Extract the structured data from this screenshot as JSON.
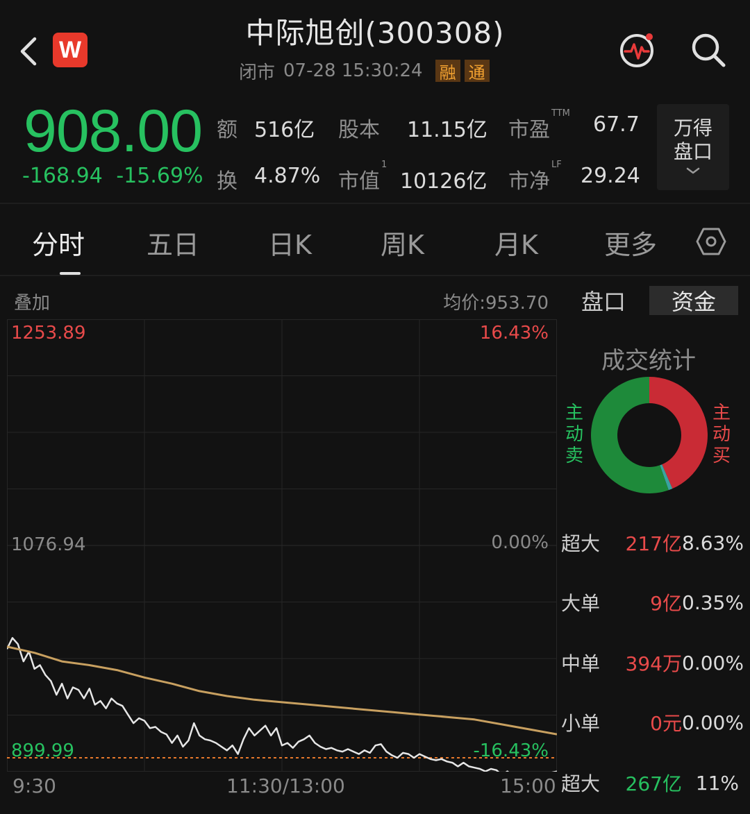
{
  "header": {
    "title": "中际旭创(300308)",
    "status": "闭市",
    "datetime": "07-28 15:30:24",
    "tags": [
      "融",
      "通"
    ],
    "logo_letter": "W"
  },
  "quote": {
    "price": "908.00",
    "change": "-168.94",
    "change_pct": "-15.69%",
    "stats": [
      {
        "label": "额",
        "value": "516亿"
      },
      {
        "label": "股本",
        "value": "11.15亿"
      },
      {
        "label": "市盈",
        "sup": "TTM",
        "value": "67.7"
      },
      {
        "label": "换",
        "value": "4.87%"
      },
      {
        "label": "市值",
        "sup": "1",
        "value": "10126亿"
      },
      {
        "label": "市净",
        "sup": "LF",
        "value": "29.24"
      }
    ],
    "wind_button": [
      "万得",
      "盘口"
    ]
  },
  "tabs": [
    "分时",
    "五日",
    "日K",
    "周K",
    "月K",
    "更多"
  ],
  "chart_header": {
    "overlay": "叠加",
    "avg_price": "均价:953.70"
  },
  "side_tabs": [
    "盘口",
    "资金"
  ],
  "chart_data": {
    "type": "line",
    "y_max": 1253.89,
    "y_mid": 1076.94,
    "y_min": 899.99,
    "pct_max": "16.43%",
    "pct_mid": "0.00%",
    "pct_min": "-16.43%",
    "time_labels": [
      "9:30",
      "11:30/13:00",
      "15:00"
    ],
    "series": [
      {
        "color": "#e6e6e6",
        "points": [
          [
            0,
            988
          ],
          [
            0.01,
            997
          ],
          [
            0.02,
            992
          ],
          [
            0.03,
            978
          ],
          [
            0.04,
            986
          ],
          [
            0.05,
            972
          ],
          [
            0.06,
            975
          ],
          [
            0.07,
            967
          ],
          [
            0.08,
            962
          ],
          [
            0.09,
            951
          ],
          [
            0.1,
            960
          ],
          [
            0.11,
            948
          ],
          [
            0.12,
            957
          ],
          [
            0.13,
            955
          ],
          [
            0.14,
            948
          ],
          [
            0.15,
            956
          ],
          [
            0.16,
            943
          ],
          [
            0.17,
            946
          ],
          [
            0.18,
            940
          ],
          [
            0.19,
            948
          ],
          [
            0.2,
            944
          ],
          [
            0.21,
            942
          ],
          [
            0.22,
            935
          ],
          [
            0.23,
            928
          ],
          [
            0.24,
            932
          ],
          [
            0.25,
            930
          ],
          [
            0.26,
            924
          ],
          [
            0.27,
            925
          ],
          [
            0.28,
            921
          ],
          [
            0.29,
            919
          ],
          [
            0.3,
            912
          ],
          [
            0.31,
            918
          ],
          [
            0.32,
            909
          ],
          [
            0.33,
            914
          ],
          [
            0.34,
            928
          ],
          [
            0.35,
            918
          ],
          [
            0.36,
            915
          ],
          [
            0.37,
            914
          ],
          [
            0.38,
            912
          ],
          [
            0.39,
            909
          ],
          [
            0.4,
            906
          ],
          [
            0.41,
            910
          ],
          [
            0.42,
            903
          ],
          [
            0.43,
            915
          ],
          [
            0.44,
            924
          ],
          [
            0.45,
            918
          ],
          [
            0.46,
            922
          ],
          [
            0.47,
            926
          ],
          [
            0.48,
            918
          ],
          [
            0.49,
            924
          ],
          [
            0.5,
            910
          ],
          [
            0.51,
            912
          ],
          [
            0.52,
            908
          ],
          [
            0.53,
            913
          ],
          [
            0.54,
            915
          ],
          [
            0.55,
            918
          ],
          [
            0.56,
            912
          ],
          [
            0.57,
            909
          ],
          [
            0.58,
            907
          ],
          [
            0.59,
            908
          ],
          [
            0.6,
            906
          ],
          [
            0.61,
            905
          ],
          [
            0.62,
            907
          ],
          [
            0.63,
            905
          ],
          [
            0.64,
            903
          ],
          [
            0.65,
            906
          ],
          [
            0.66,
            904
          ],
          [
            0.67,
            910
          ],
          [
            0.68,
            911
          ],
          [
            0.69,
            905
          ],
          [
            0.7,
            902
          ],
          [
            0.71,
            900
          ],
          [
            0.72,
            904
          ],
          [
            0.73,
            903
          ],
          [
            0.74,
            900
          ],
          [
            0.75,
            903
          ],
          [
            0.76,
            901
          ],
          [
            0.77,
            899
          ],
          [
            0.78,
            898
          ],
          [
            0.79,
            899
          ],
          [
            0.8,
            897
          ],
          [
            0.81,
            896
          ],
          [
            0.82,
            893
          ],
          [
            0.83,
            896
          ],
          [
            0.84,
            893
          ],
          [
            0.85,
            892
          ],
          [
            0.86,
            891
          ],
          [
            0.87,
            889
          ],
          [
            0.88,
            891
          ],
          [
            0.89,
            890
          ],
          [
            0.9,
            886
          ],
          [
            0.91,
            889
          ],
          [
            0.92,
            885
          ],
          [
            0.93,
            883
          ],
          [
            0.94,
            885
          ],
          [
            0.95,
            883
          ],
          [
            0.96,
            888
          ],
          [
            0.97,
            886
          ],
          [
            0.98,
            885
          ],
          [
            0.99,
            888
          ],
          [
            1,
            889
          ]
        ]
      },
      {
        "color": "#c8a060",
        "points": [
          [
            0,
            990
          ],
          [
            0.05,
            985
          ],
          [
            0.1,
            978
          ],
          [
            0.15,
            975
          ],
          [
            0.2,
            971
          ],
          [
            0.25,
            965
          ],
          [
            0.3,
            960
          ],
          [
            0.35,
            954
          ],
          [
            0.4,
            950
          ],
          [
            0.45,
            947
          ],
          [
            0.5,
            945
          ],
          [
            0.55,
            943
          ],
          [
            0.6,
            941
          ],
          [
            0.65,
            939
          ],
          [
            0.7,
            937
          ],
          [
            0.75,
            935
          ],
          [
            0.8,
            933
          ],
          [
            0.85,
            931
          ],
          [
            0.9,
            927
          ],
          [
            0.95,
            923
          ],
          [
            1,
            919
          ]
        ]
      }
    ]
  },
  "fund_stats": {
    "title": "成交统计",
    "sell_label": "主动卖",
    "buy_label": "主动买",
    "donut": {
      "buy_pct": 0.44,
      "sell_pct": 0.56,
      "buy_color": "#c92b35",
      "sell_color": "#1e8a3a",
      "mid_color": "#3aa3a0"
    },
    "rows": [
      {
        "label": "超大",
        "amount": "217亿",
        "pct": "8.63%",
        "amount_color": "#e84a4a"
      },
      {
        "label": "大单",
        "amount": "9亿",
        "pct": "0.35%",
        "amount_color": "#e84a4a"
      },
      {
        "label": "中单",
        "amount": "394万",
        "pct": "0.00%",
        "amount_color": "#e84a4a"
      },
      {
        "label": "小单",
        "amount": "0元",
        "pct": "0.00%",
        "amount_color": "#e84a4a"
      },
      {
        "label": "超大",
        "amount": "267亿",
        "pct": "11%",
        "amount_color": "#27c160"
      }
    ]
  },
  "colors": {
    "up": "#e84a4a",
    "down": "#27c160",
    "background": "#121212"
  }
}
